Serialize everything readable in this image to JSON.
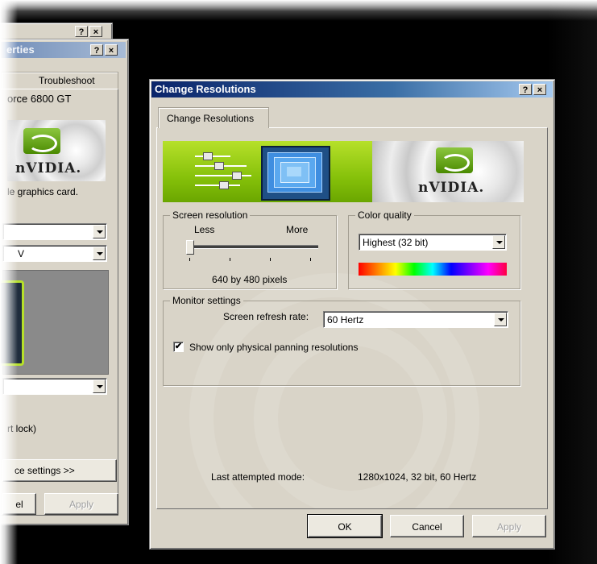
{
  "back_window": {
    "title_fragment": "erties",
    "tab_troubleshoot": "Troubleshoot",
    "adapter_fragment": "orce 6800 GT",
    "graphics_card_fragment": "le graphics card.",
    "select_2_value": "V",
    "brand": "nVIDIA.",
    "hot_lock_fragment": "rt lock)",
    "advanced_button_fragment": "ce settings >>",
    "cancel_fragment": "el",
    "apply_label": "Apply"
  },
  "dialog": {
    "title": "Change Resolutions",
    "tab_label": "Change Resolutions",
    "brand": "nVIDIA.",
    "screen_resolution": {
      "legend": "Screen resolution",
      "less_label": "Less",
      "more_label": "More",
      "slider_position": 0,
      "value_text": "640 by 480 pixels"
    },
    "color_quality": {
      "legend": "Color quality",
      "selected": "Highest (32 bit)"
    },
    "monitor_settings": {
      "legend": "Monitor settings",
      "refresh_label": "Screen refresh rate:",
      "refresh_selected": "60 Hertz",
      "checkbox_label": "Show only physical panning resolutions",
      "checkbox_checked": true
    },
    "last_mode_label": "Last attempted mode:",
    "last_mode_value": "1280x1024, 32 bit, 60 Hertz",
    "ok_label": "OK",
    "cancel_label": "Cancel",
    "apply_label": "Apply"
  },
  "titlebar_buttons": {
    "help": "?",
    "close": "×"
  }
}
